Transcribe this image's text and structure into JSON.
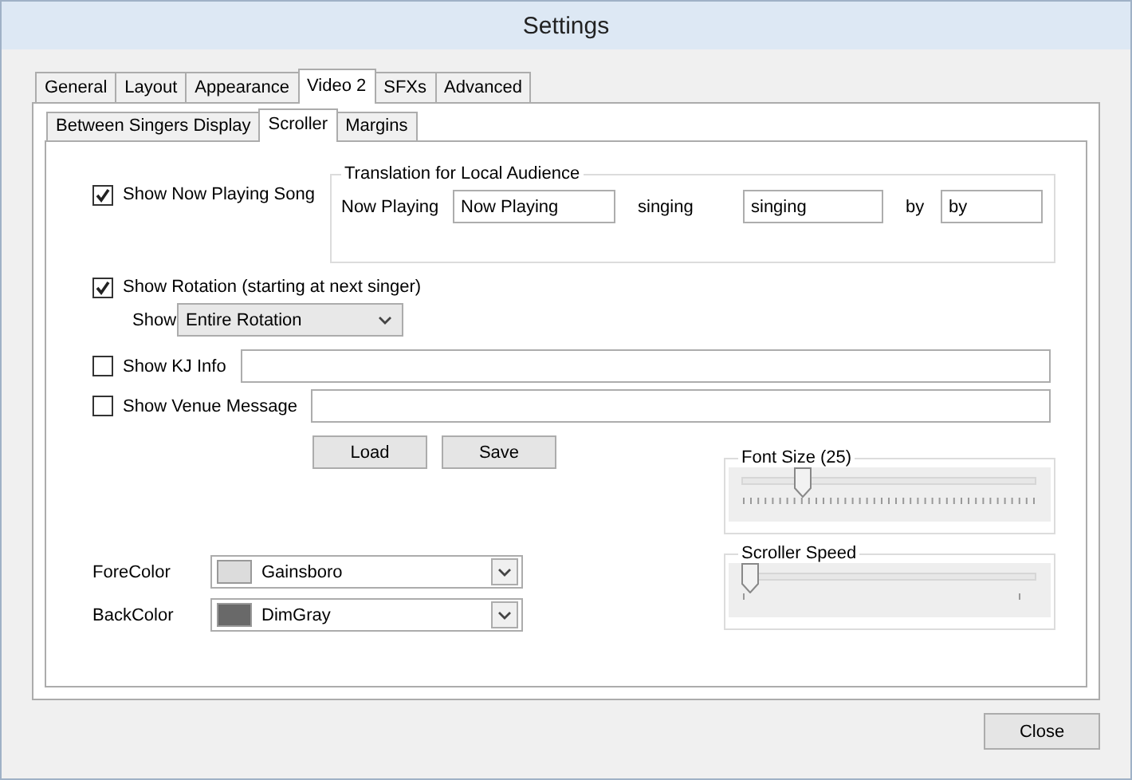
{
  "window": {
    "title": "Settings"
  },
  "tabs": [
    {
      "label": "General",
      "selected": false
    },
    {
      "label": "Layout",
      "selected": false
    },
    {
      "label": "Appearance",
      "selected": false
    },
    {
      "label": "Video 2",
      "selected": true
    },
    {
      "label": "SFXs",
      "selected": false
    },
    {
      "label": "Advanced",
      "selected": false
    }
  ],
  "subtabs": [
    {
      "label": "Between Singers Display",
      "selected": false
    },
    {
      "label": "Scroller",
      "selected": true
    },
    {
      "label": "Margins",
      "selected": false
    }
  ],
  "now_playing": {
    "label": "Show Now Playing Song",
    "checked": true
  },
  "translation": {
    "title": "Translation for Local Audience",
    "fields": [
      {
        "label": "Now Playing",
        "value": "Now Playing"
      },
      {
        "label": "singing",
        "value": "singing"
      },
      {
        "label": "by",
        "value": "by"
      }
    ]
  },
  "rotation": {
    "label": "Show Rotation (starting at next singer)",
    "checked": true,
    "show_label": "Show",
    "show_value": "Entire Rotation"
  },
  "kj_info": {
    "label": "Show KJ Info",
    "checked": false
  },
  "venue_message": {
    "label": "Show Venue Message",
    "checked": false
  },
  "file_buttons": [
    "Load",
    "Save"
  ],
  "colors": [
    {
      "label": "ForeColor",
      "value": "Gainsboro",
      "color": "#dcdcdc"
    },
    {
      "label": "BackColor",
      "value": "DimGray",
      "color": "#696969"
    }
  ],
  "sliders": [
    {
      "label": "Font Size (25)",
      "level": 0.18,
      "kind": "dense"
    },
    {
      "label": "Scroller Speed",
      "level": 0,
      "kind": "ends"
    }
  ],
  "close_button": "Close"
}
